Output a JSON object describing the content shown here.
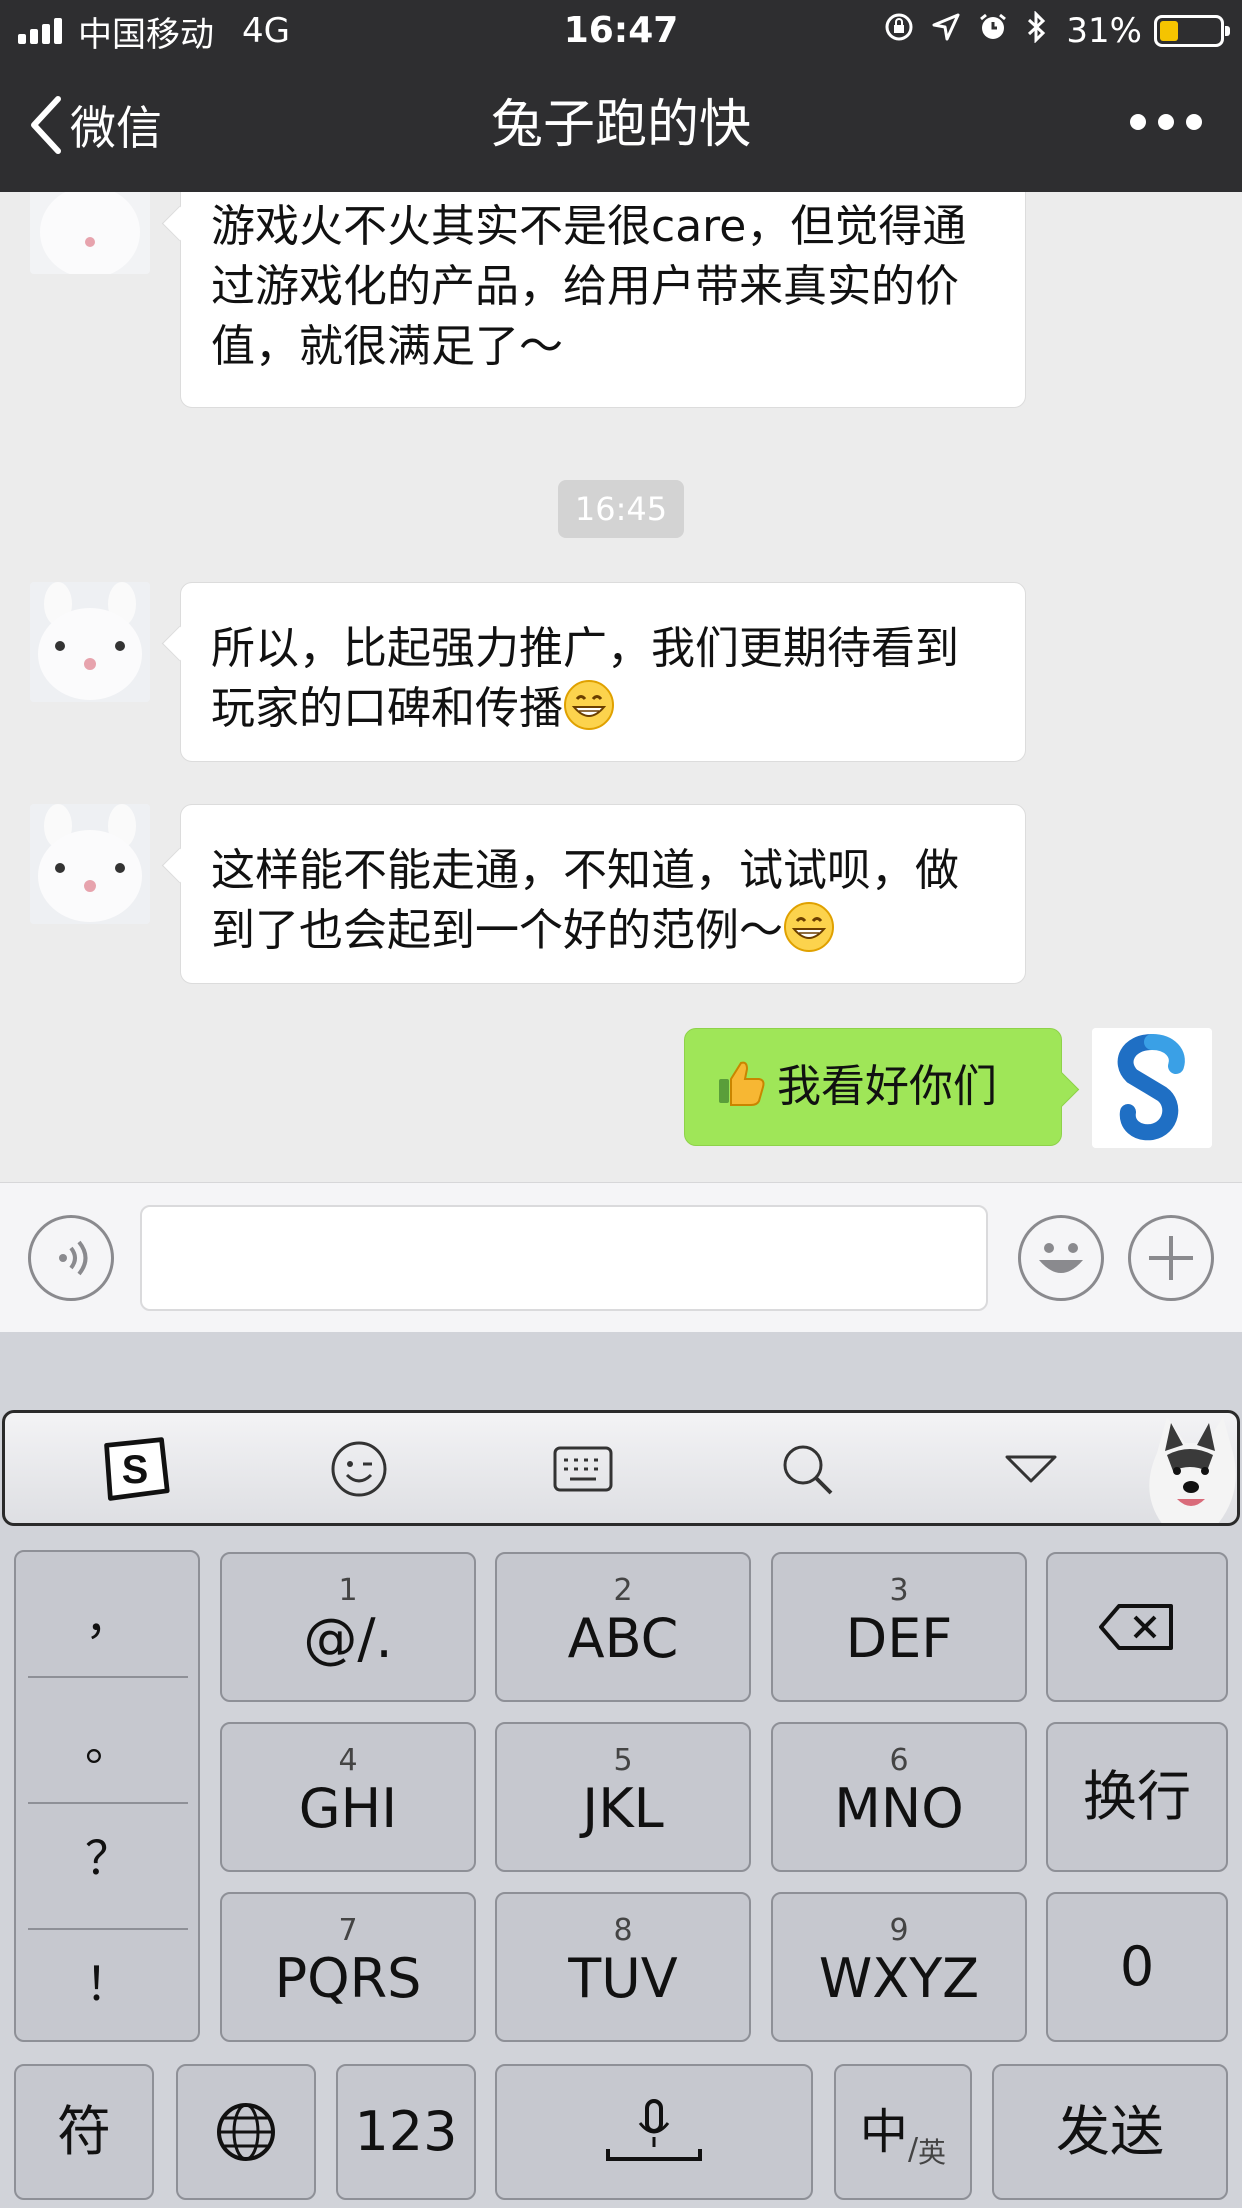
{
  "status_bar": {
    "carrier": "中国移动",
    "network": "4G",
    "time": "16:47",
    "battery_percent": "31%",
    "battery_level": 0.31
  },
  "nav": {
    "back_label": "微信",
    "title": "兔子跑的快"
  },
  "chat": {
    "messages": [
      {
        "side": "left",
        "text": "游戏火不火其实不是很care，但觉得通过游戏化的产品，给用户带来真实的价值，就很满足了～"
      },
      {
        "side": "left",
        "text": "所以，比起强力推广，我们更期待看到玩家的口碑和传播"
      },
      {
        "side": "left",
        "text": "这样能不能走通，不知道，试试呗，做到了也会起到一个好的范例～"
      },
      {
        "side": "right",
        "text": "我看好你们"
      }
    ],
    "timestamp": "16:45"
  },
  "input": {
    "value": ""
  },
  "keyboard": {
    "punctuation": [
      "，",
      "。",
      "？",
      "！"
    ],
    "row1": [
      {
        "num": "1",
        "label": "@/."
      },
      {
        "num": "2",
        "label": "ABC"
      },
      {
        "num": "3",
        "label": "DEF"
      }
    ],
    "row2": [
      {
        "num": "4",
        "label": "GHI"
      },
      {
        "num": "5",
        "label": "JKL"
      },
      {
        "num": "6",
        "label": "MNO"
      }
    ],
    "row3": [
      {
        "num": "7",
        "label": "PQRS"
      },
      {
        "num": "8",
        "label": "TUV"
      },
      {
        "num": "9",
        "label": "WXYZ"
      }
    ],
    "newline": "换行",
    "zero": "0",
    "symbols": "符",
    "numbers": "123",
    "lang_zh": "中",
    "lang_en": "英",
    "send": "发送"
  },
  "colors": {
    "nav_bg": "#2e2e30",
    "chat_bg": "#ececec",
    "sent_bubble": "#9fe658",
    "keyboard_bg": "#d1d3d9",
    "key_bg": "#c6c8cf"
  }
}
